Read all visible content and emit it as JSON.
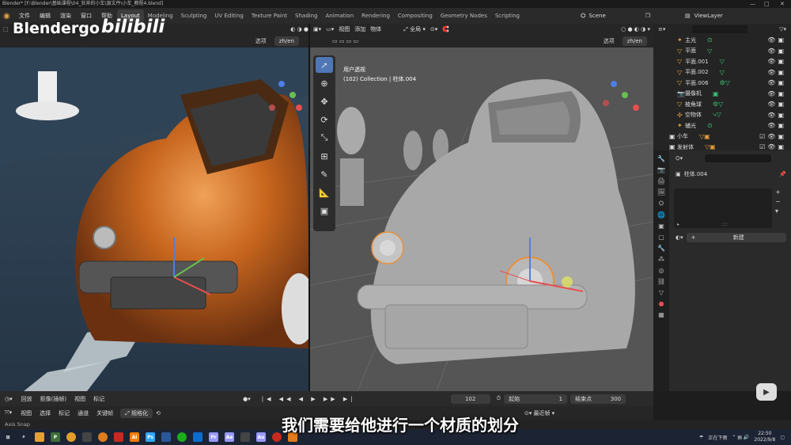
{
  "window": {
    "title": "Blender* [F:\\Blender\\基础课程\\04_狂奔的小车\\源文件\\小车_教程4.blend]",
    "controls": [
      "—",
      "□",
      "✕"
    ]
  },
  "topbar": {
    "menus": [
      "文件",
      "编辑",
      "渲染",
      "窗口",
      "帮助"
    ],
    "workspaces": [
      "Layout",
      "Modeling",
      "Sculpting",
      "UV Editing",
      "Texture Paint",
      "Shading",
      "Animation",
      "Rendering",
      "Compositing",
      "Geometry Nodes",
      "Scripting"
    ],
    "active_workspace": "Layout",
    "scene_label": "Scene",
    "view_layer_label": "ViewLayer"
  },
  "brand": {
    "text": "Blendergo",
    "bili": "bilibili"
  },
  "left_viewport": {
    "options_label": "选项",
    "lang_button": "zh/en"
  },
  "right_viewport": {
    "menus": [
      "视图",
      "添加",
      "物体"
    ],
    "transform_orientation": "全局",
    "options_label": "选项",
    "lang_button": "zh/en",
    "overlay_line1": "用户透视",
    "overlay_line2": "(102) Collection | 柱体.004",
    "tools": [
      "select-box",
      "cursor",
      "move",
      "rotate",
      "scale",
      "transform",
      "annotate",
      "measure",
      "add-cube"
    ]
  },
  "outliner": {
    "search_placeholder": "",
    "rows": [
      {
        "label": "主光",
        "icon": "light-icon",
        "indent": 1
      },
      {
        "label": "平面",
        "icon": "mesh-icon",
        "indent": 1
      },
      {
        "label": "平面.001",
        "icon": "mesh-icon",
        "indent": 1
      },
      {
        "label": "平面.002",
        "icon": "mesh-icon",
        "indent": 1
      },
      {
        "label": "平面.006",
        "icon": "mesh-icon",
        "indent": 1
      },
      {
        "label": "摄像机",
        "icon": "camera-icon",
        "indent": 1
      },
      {
        "label": "棱角球",
        "icon": "mesh-icon",
        "indent": 1
      },
      {
        "label": "空物体",
        "icon": "empty-icon",
        "indent": 1
      },
      {
        "label": "辅光",
        "icon": "light-icon",
        "indent": 1
      },
      {
        "label": "小车",
        "icon": "collection-icon",
        "indent": 0
      },
      {
        "label": "发射体",
        "icon": "collection-icon",
        "indent": 0
      }
    ]
  },
  "properties": {
    "object_name": "柱体.004",
    "new_button": "新建",
    "slot_dots": "::::"
  },
  "timeline": {
    "menus": [
      "回放",
      "抠像(插帧)",
      "视图",
      "标记"
    ],
    "current_frame": "102",
    "start_label": "起始",
    "start_value": "1",
    "end_label": "结束点",
    "end_value": "300"
  },
  "timeline2": {
    "menus": [
      "视图",
      "选择",
      "标记",
      "通道",
      "关键帧"
    ],
    "normalize_label": "规格化",
    "snap_label": "最近帧"
  },
  "status": {
    "text": "Axis Snap"
  },
  "taskbar": {
    "clock_time": "22:50",
    "clock_date": "2022/9/8",
    "tray_text": "正在下雨"
  },
  "subtitle": "我们需要给他进行一个材质的划分",
  "colors": {
    "accent": "#5077b5",
    "orange_car": "#c8661e",
    "road": "#2c3e4f",
    "ui_bg": "#2a2a2a"
  }
}
